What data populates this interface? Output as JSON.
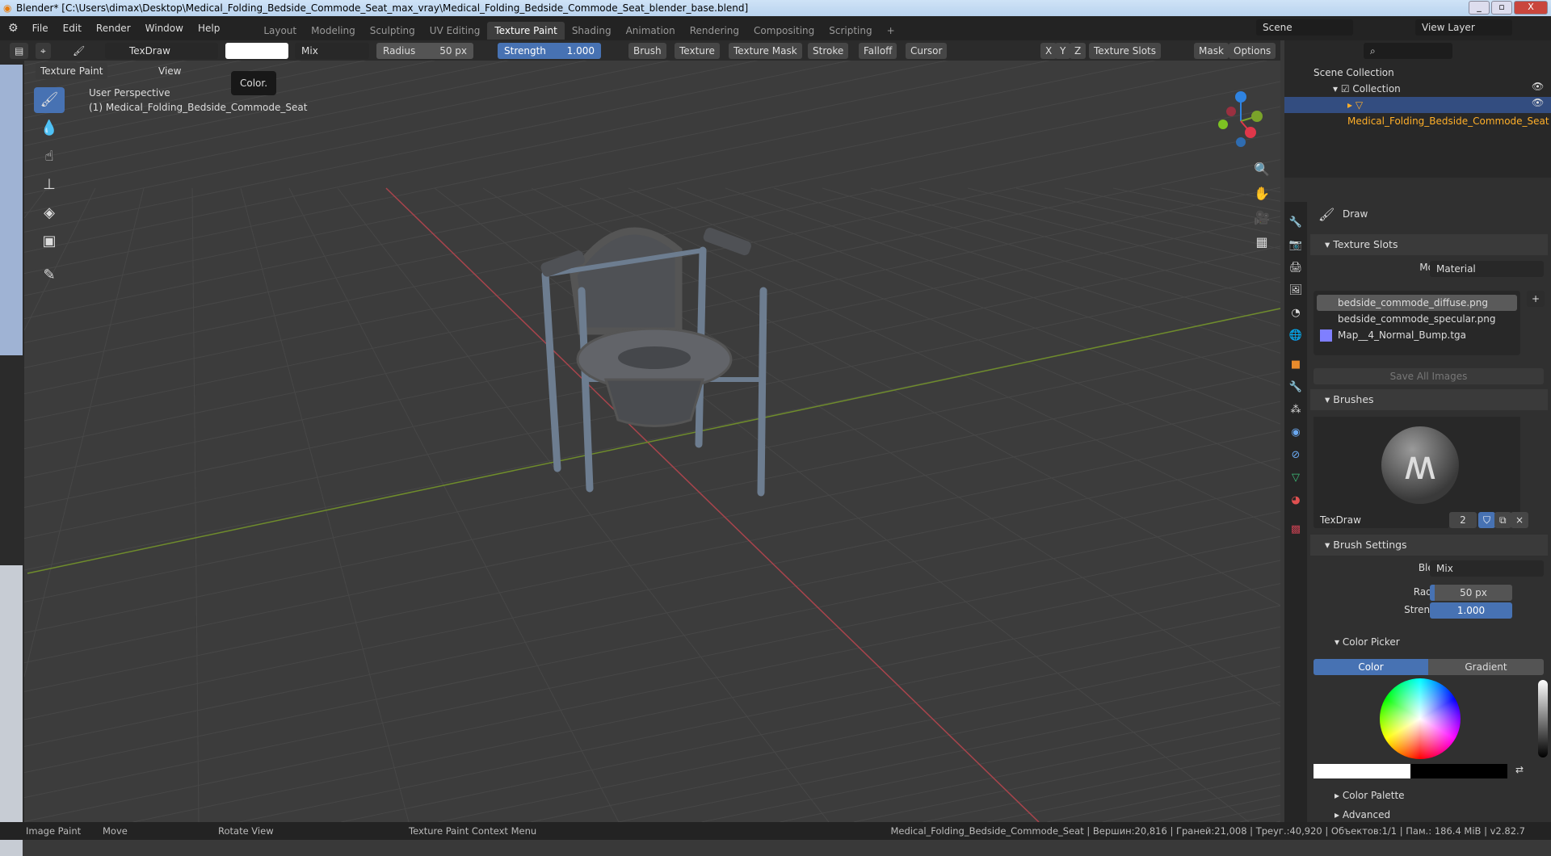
{
  "titlebar": {
    "title": "Blender* [C:\\Users\\dimax\\Desktop\\Medical_Folding_Bedside_Commode_Seat_max_vray\\Medical_Folding_Bedside_Commode_Seat_blender_base.blend]",
    "min": "_",
    "max": "▫",
    "close": "X"
  },
  "menus": [
    "File",
    "Edit",
    "Render",
    "Window",
    "Help"
  ],
  "workspaces": [
    "Layout",
    "Modeling",
    "Sculpting",
    "UV Editing",
    "Texture Paint",
    "Shading",
    "Animation",
    "Rendering",
    "Compositing",
    "Scripting",
    "+"
  ],
  "active_workspace": "Texture Paint",
  "scene": "Scene",
  "view_layer": "View Layer",
  "toolheader": {
    "brush": "TexDraw",
    "blend": "Mix",
    "radius_label": "Radius",
    "radius": "50 px",
    "strength_label": "Strength",
    "strength": "1.000",
    "menus": [
      "Brush",
      "Texture",
      "Texture Mask",
      "Stroke",
      "Falloff",
      "Cursor"
    ],
    "xyz": [
      "X",
      "Y",
      "Z"
    ],
    "texture_slots": "Texture Slots",
    "mask": "Mask",
    "options": "Options",
    "color": "#ffffff"
  },
  "viewheader": {
    "mode": "Texture Paint",
    "view": "View",
    "tooltip": "Color."
  },
  "viewport": {
    "perspective": "User Perspective",
    "object": "(1) Medical_Folding_Bedside_Commode_Seat"
  },
  "outliner": {
    "scene_collection": "Scene Collection",
    "collection": "Collection",
    "object": "Medical_Folding_Bedside_Commode_Seat"
  },
  "props": {
    "tool": "Draw",
    "texture_slots": "Texture Slots",
    "mode_label": "Mode",
    "mode": "Material",
    "slots": [
      "bedside_commode_diffuse.png",
      "bedside_commode_specular.png",
      "Map__4_Normal_Bump.tga"
    ],
    "save_all": "Save All Images",
    "brushes": "Brushes",
    "brush_name": "TexDraw",
    "brush_users": "2",
    "brush_settings": "Brush Settings",
    "blend_label": "Blend",
    "blend": "Mix",
    "radius_label": "Radius",
    "radius": "50 px",
    "strength_label": "Strength",
    "strength": "1.000",
    "color_picker": "Color Picker",
    "tab_color": "Color",
    "tab_gradient": "Gradient",
    "color_palette": "Color Palette",
    "advanced": "Advanced"
  },
  "statusbar": {
    "left": [
      "Image Paint",
      "Move",
      "Rotate View",
      "Texture Paint Context Menu"
    ],
    "right": "Medical_Folding_Bedside_Commode_Seat | Вершин:20,816 | Граней:21,008 | Треуг.:40,920 | Объектов:1/1 | Пам.: 186.4 MiB | v2.82.7"
  }
}
